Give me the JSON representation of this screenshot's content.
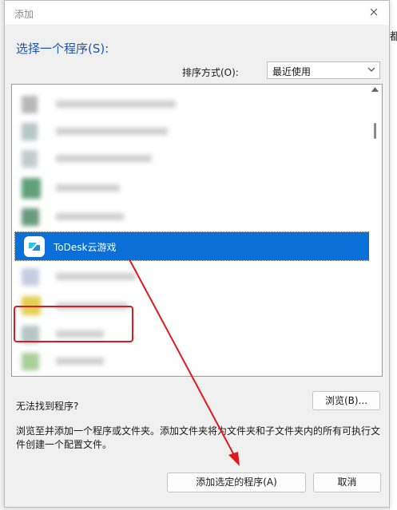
{
  "dialog": {
    "title": "添加",
    "heading": "选择一个程序(S):",
    "sort_label": "排序方式(O):",
    "sort_value": "最近使用",
    "selected_program": "ToDesk云游戏",
    "not_found_label": "无法找到程序?",
    "browse_label": "浏览(B)...",
    "description": "浏览至并添加一个程序或文件夹。添加文件夹将为文件夹和子文件夹内的所有可执行文件创建一个配置文件。",
    "add_label": "添加选定的程序(A)",
    "cancel_label": "取消"
  },
  "background": {
    "right_edge_char": "都"
  },
  "colors": {
    "accent": "#1a55b8",
    "selection": "#0a6fd6",
    "annotation": "#e0191d"
  },
  "icons": {
    "close": "close-icon",
    "dropdown": "chevron-down-icon",
    "program": "todesk-icon"
  }
}
